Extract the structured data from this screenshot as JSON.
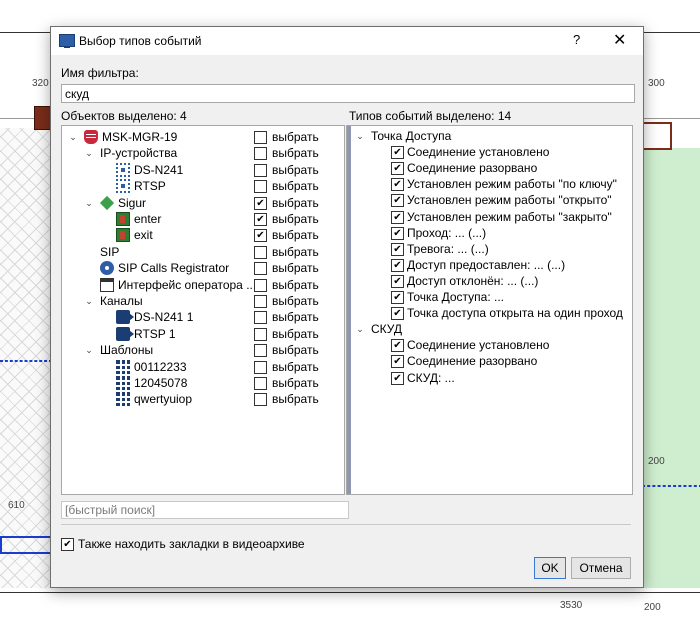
{
  "dialog": {
    "title": "Выбор типов событий",
    "help_symbol": "?",
    "close_symbol": "✕",
    "filter_label": "Имя фильтра:",
    "filter_value": "скуд",
    "objects_selected": "Объектов выделено: 4",
    "types_selected": "Типов событий выделено: 14",
    "search_placeholder": "[быстрый поиск]",
    "bookmark_label": "Также находить закладки в видеоархиве",
    "bookmark_checked": true,
    "ok_label": "OK",
    "cancel_label": "Отмена"
  },
  "tree": [
    {
      "label": "MSK-MGR-19",
      "icon": "server-icon",
      "level": 0,
      "expanded": true,
      "checked": false,
      "select_label": "выбрать"
    },
    {
      "label": "IP-устройства",
      "icon": "",
      "level": 1,
      "expanded": true,
      "checked": false,
      "select_label": "выбрать"
    },
    {
      "label": "DS-N241",
      "icon": "ip-device-icon",
      "level": 2,
      "expanded": null,
      "checked": false,
      "select_label": "выбрать"
    },
    {
      "label": "RTSP",
      "icon": "ip-device-icon",
      "level": 2,
      "expanded": null,
      "checked": false,
      "select_label": "выбрать"
    },
    {
      "label": "Sigur",
      "icon": "sigur-diamond-icon",
      "level": 1,
      "expanded": true,
      "checked": true,
      "select_label": "выбрать"
    },
    {
      "label": "enter",
      "icon": "door-icon",
      "level": 2,
      "expanded": null,
      "checked": true,
      "select_label": "выбрать"
    },
    {
      "label": "exit",
      "icon": "door-icon",
      "level": 2,
      "expanded": null,
      "checked": true,
      "select_label": "выбрать"
    },
    {
      "label": "SIP",
      "icon": "",
      "level": 1,
      "expanded": null,
      "checked": false,
      "select_label": "выбрать"
    },
    {
      "label": "SIP Calls Registrator",
      "icon": "gear-icon",
      "level": 1,
      "expanded": null,
      "checked": false,
      "select_label": "выбрать"
    },
    {
      "label": "Интерфейс оператора ...",
      "icon": "window-icon",
      "level": 1,
      "expanded": null,
      "checked": false,
      "select_label": "выбрать"
    },
    {
      "label": "Каналы",
      "icon": "",
      "level": 1,
      "expanded": true,
      "checked": false,
      "select_label": "выбрать"
    },
    {
      "label": "DS-N241 1",
      "icon": "camera-icon",
      "level": 2,
      "expanded": null,
      "checked": false,
      "select_label": "выбрать"
    },
    {
      "label": "RTSP 1",
      "icon": "camera-icon",
      "level": 2,
      "expanded": null,
      "checked": false,
      "select_label": "выбрать"
    },
    {
      "label": "Шаблоны",
      "icon": "",
      "level": 1,
      "expanded": true,
      "checked": false,
      "select_label": "выбрать"
    },
    {
      "label": "00112233",
      "icon": "layout-grid-icon",
      "level": 2,
      "expanded": null,
      "checked": false,
      "select_label": "выбрать"
    },
    {
      "label": "12045078",
      "icon": "layout-grid-icon",
      "level": 2,
      "expanded": null,
      "checked": false,
      "select_label": "выбрать"
    },
    {
      "label": "qwertyuiop",
      "icon": "layout-grid-icon",
      "level": 2,
      "expanded": null,
      "checked": false,
      "select_label": "выбрать"
    }
  ],
  "event_groups": [
    {
      "label": "Точка Доступа",
      "items": [
        {
          "label": "Соединение установлено",
          "checked": true
        },
        {
          "label": "Соединение разорвано",
          "checked": true
        },
        {
          "label": "Установлен режим работы \"по ключу\"",
          "checked": true
        },
        {
          "label": "Установлен режим работы \"открыто\"",
          "checked": true
        },
        {
          "label": "Установлен режим работы \"закрыто\"",
          "checked": true
        },
        {
          "label": "Проход: ... (...)",
          "checked": true
        },
        {
          "label": "Тревога: ... (...)",
          "checked": true
        },
        {
          "label": "Доступ предоставлен: ... (...)",
          "checked": true
        },
        {
          "label": "Доступ отклонён: ... (...)",
          "checked": true
        },
        {
          "label": "Точка Доступа: ...",
          "checked": true
        },
        {
          "label": "Точка доступа открыта на один проход",
          "checked": true
        }
      ]
    },
    {
      "label": "СКУД",
      "items": [
        {
          "label": "Соединение установлено",
          "checked": true
        },
        {
          "label": "Соединение разорвано",
          "checked": true
        },
        {
          "label": "СКУД: ...",
          "checked": true
        }
      ]
    }
  ],
  "background": {
    "labels": [
      "320",
      "300",
      "200",
      "200",
      "610",
      "3530"
    ]
  }
}
